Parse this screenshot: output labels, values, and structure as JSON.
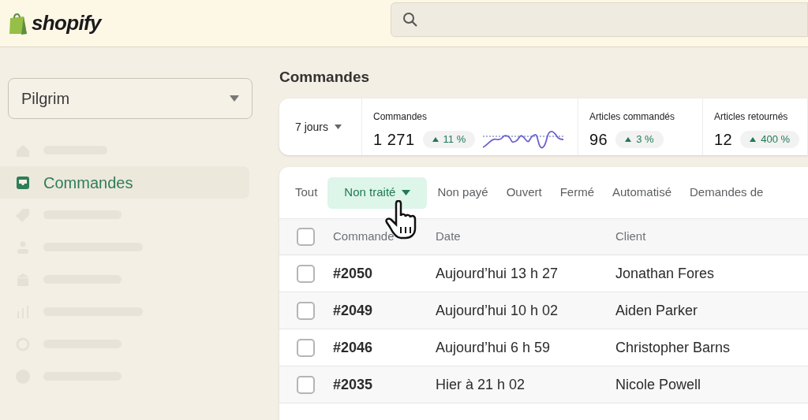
{
  "header": {
    "logo_text": "shopify"
  },
  "store_selector": {
    "value": "Pilgrim"
  },
  "sidebar": {
    "items": [
      {
        "kind": "placeholder"
      },
      {
        "kind": "item",
        "label": "Commandes",
        "selected": true
      },
      {
        "kind": "placeholder"
      },
      {
        "kind": "placeholder"
      },
      {
        "kind": "placeholder"
      },
      {
        "kind": "placeholder"
      },
      {
        "kind": "placeholder"
      },
      {
        "kind": "placeholder"
      }
    ]
  },
  "page_title": "Commandes",
  "stats": {
    "period": "7 jours",
    "metrics": [
      {
        "kind": "sparkline",
        "label": "Commandes",
        "value": "1 271",
        "change": "11 %"
      },
      {
        "kind": "plain",
        "label": "Articles commandés",
        "value": "96",
        "change": "3 %"
      },
      {
        "kind": "plain",
        "label": "Articles retournés",
        "value": "12",
        "change": "400 %"
      }
    ]
  },
  "tabs": [
    {
      "kind": "plain",
      "label": "Tout",
      "selected": false
    },
    {
      "kind": "dropdown",
      "label": "Non traité",
      "selected": true
    },
    {
      "kind": "plain",
      "label": "Non payé",
      "selected": false
    },
    {
      "kind": "plain",
      "label": "Ouvert",
      "selected": false
    },
    {
      "kind": "plain",
      "label": "Fermé",
      "selected": false
    },
    {
      "kind": "plain",
      "label": "Automatisé",
      "selected": false
    },
    {
      "kind": "plain",
      "label": "Demandes de",
      "selected": false
    }
  ],
  "table": {
    "select_all_checked": false,
    "columns": [
      "Commande",
      "Date",
      "Client"
    ],
    "rows": [
      {
        "checked": false,
        "cells": [
          "#2050",
          "Aujourd’hui 13 h 27",
          "Jonathan Fores"
        ]
      },
      {
        "checked": false,
        "cells": [
          "#2049",
          "Aujourd’hui 10 h 02",
          "Aiden Parker"
        ]
      },
      {
        "checked": false,
        "cells": [
          "#2046",
          "Aujourd’hui 6 h 59",
          "Christopher Barns"
        ]
      },
      {
        "checked": false,
        "cells": [
          "#2035",
          "Hier à 21 h 02",
          "Nicole Powell"
        ]
      }
    ]
  }
}
